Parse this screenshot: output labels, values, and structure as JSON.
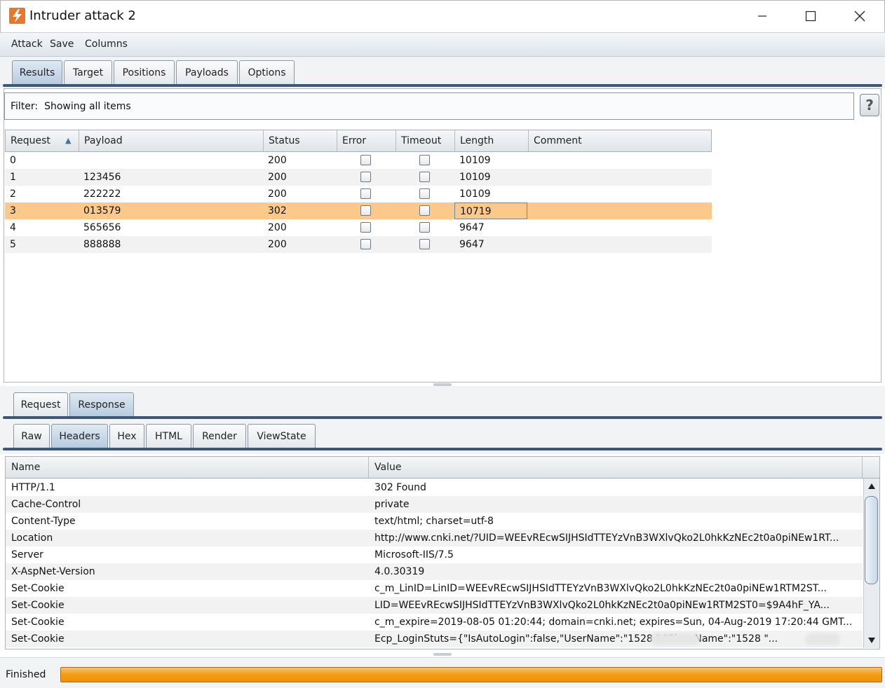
{
  "window": {
    "title": "Intruder attack 2"
  },
  "menu": [
    "Attack",
    "Save",
    "Columns"
  ],
  "top_tabs": [
    "Results",
    "Target",
    "Positions",
    "Payloads",
    "Options"
  ],
  "filter": {
    "label": "Filter:",
    "text": "Showing all items",
    "help_label": "?"
  },
  "results_table": {
    "columns": [
      "Request",
      "Payload",
      "Status",
      "Error",
      "Timeout",
      "Length",
      "Comment"
    ],
    "sort_indicator": "▲",
    "rows": [
      {
        "request": "0",
        "payload": "",
        "status": "200",
        "error": false,
        "timeout": false,
        "length": "10109",
        "comment": ""
      },
      {
        "request": "1",
        "payload": "123456",
        "status": "200",
        "error": false,
        "timeout": false,
        "length": "10109",
        "comment": ""
      },
      {
        "request": "2",
        "payload": "222222",
        "status": "200",
        "error": false,
        "timeout": false,
        "length": "10109",
        "comment": ""
      },
      {
        "request": "3",
        "payload": "013579",
        "status": "302",
        "error": false,
        "timeout": false,
        "length": "10719",
        "comment": ""
      },
      {
        "request": "4",
        "payload": "565656",
        "status": "200",
        "error": false,
        "timeout": false,
        "length": "9647",
        "comment": ""
      },
      {
        "request": "5",
        "payload": "888888",
        "status": "200",
        "error": false,
        "timeout": false,
        "length": "9647",
        "comment": ""
      }
    ],
    "selected_row": 3,
    "selected_color": "#fcc98b"
  },
  "rr_tabs": [
    "Request",
    "Response"
  ],
  "view_tabs": [
    "Raw",
    "Headers",
    "Hex",
    "HTML",
    "Render",
    "ViewState"
  ],
  "headers_table": {
    "columns": [
      "Name",
      "Value"
    ],
    "rows": [
      {
        "name": "HTTP/1.1",
        "value": "302 Found"
      },
      {
        "name": "Cache-Control",
        "value": "private"
      },
      {
        "name": "Content-Type",
        "value": "text/html; charset=utf-8"
      },
      {
        "name": "Location",
        "value": "http://www.cnki.net/?UID=WEEvREcwSIJHSIdTTEYzVnB3WXlvQko2L0hkKzNEc2t0a0piNEw1RT..."
      },
      {
        "name": "Server",
        "value": "Microsoft-IIS/7.5"
      },
      {
        "name": "X-AspNet-Version",
        "value": "4.0.30319"
      },
      {
        "name": "Set-Cookie",
        "value": "c_m_LinID=LinID=WEEvREcwSIJHSIdTTEYzVnB3WXlvQko2L0hkKzNEc2t0a0piNEw1RTM2ST..."
      },
      {
        "name": "Set-Cookie",
        "value": "LID=WEEvREcwSIJHSIdTTEYzVnB3WXlvQko2L0hkKzNEc2t0a0piNEw1RTM2ST0=$9A4hF_YA..."
      },
      {
        "name": "Set-Cookie",
        "value": "c_m_expire=2019-08-05 01:20:44; domain=cnki.net; expires=Sun, 04-Aug-2019 17:20:44 GMT..."
      },
      {
        "name": "Set-Cookie",
        "value": "Ecp_LoginStuts={\"IsAutoLogin\":false,\"UserName\":\"1528          \",\"ShowName\":\"1528        \"..."
      }
    ]
  },
  "status": {
    "text": "Finished",
    "progress": 1.0,
    "progress_color": "#f39d14"
  },
  "colors": {
    "tab_line": "#3d5876",
    "brand": "#e8772e"
  },
  "icons": {
    "app": "burp-lightning-icon",
    "minimize": "minimize-icon",
    "maximize": "maximize-icon",
    "close": "close-icon",
    "help": "help-icon"
  }
}
